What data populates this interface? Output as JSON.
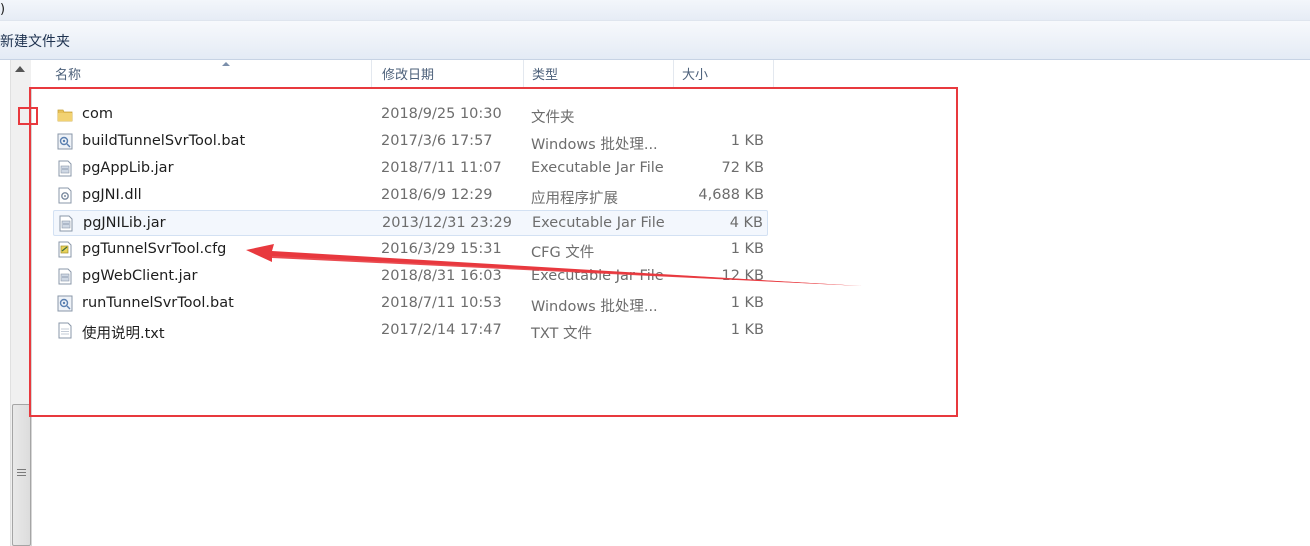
{
  "menu": {
    "fragment": ")"
  },
  "toolbar": {
    "new_folder": "新建文件夹"
  },
  "columns": {
    "name": "名称",
    "date": "修改日期",
    "type": "类型",
    "size": "大小"
  },
  "files": [
    {
      "name": "com",
      "date": "2018/9/25 10:30",
      "type": "文件夹",
      "size": "",
      "icon": "folder-icon"
    },
    {
      "name": "buildTunnelSvrTool.bat",
      "date": "2017/3/6 17:57",
      "type": "Windows 批处理...",
      "size": "1 KB",
      "icon": "batch-file-icon"
    },
    {
      "name": "pgAppLib.jar",
      "date": "2018/7/11 11:07",
      "type": "Executable Jar File",
      "size": "72 KB",
      "icon": "jar-file-icon"
    },
    {
      "name": "pgJNI.dll",
      "date": "2018/6/9 12:29",
      "type": "应用程序扩展",
      "size": "4,688 KB",
      "icon": "dll-file-icon"
    },
    {
      "name": "pgJNILib.jar",
      "date": "2013/12/31 23:29",
      "type": "Executable Jar File",
      "size": "4 KB",
      "icon": "jar-file-icon"
    },
    {
      "name": "pgTunnelSvrTool.cfg",
      "date": "2016/3/29 15:31",
      "type": "CFG 文件",
      "size": "1 KB",
      "icon": "cfg-file-icon"
    },
    {
      "name": "pgWebClient.jar",
      "date": "2018/8/31 16:03",
      "type": "Executable Jar File",
      "size": "12 KB",
      "icon": "jar-file-icon"
    },
    {
      "name": "runTunnelSvrTool.bat",
      "date": "2018/7/11 10:53",
      "type": "Windows 批处理...",
      "size": "1 KB",
      "icon": "batch-file-icon"
    },
    {
      "name": "使用说明.txt",
      "date": "2017/2/14 17:47",
      "type": "TXT 文件",
      "size": "1 KB",
      "icon": "text-file-icon"
    }
  ],
  "hover_row_index": 4,
  "colors": {
    "annotation": "#e8393e",
    "hover_bg": "#f3f7fd",
    "folder": "#e8c25a"
  }
}
